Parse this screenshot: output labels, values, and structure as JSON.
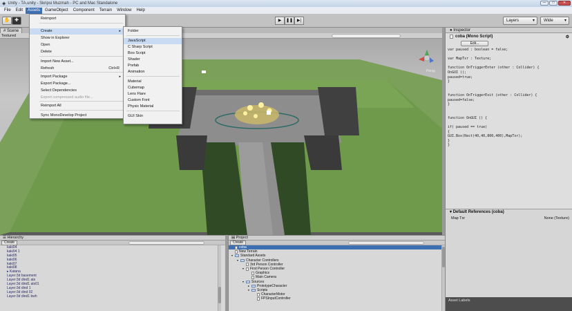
{
  "window": {
    "title": "Unity - TA.unity - Skripsi Muzmah - PC and Mac Standalone",
    "buttons": [
      "—",
      "□",
      "✕"
    ]
  },
  "menubar": [
    "File",
    "Edit",
    "Assets",
    "GameObject",
    "Component",
    "Terrain",
    "Window",
    "Help"
  ],
  "toolbar": {
    "play": "▶",
    "pause": "❚❚",
    "step": "▶|",
    "layers": "Layers",
    "layout": "Wide"
  },
  "scene": {
    "tab": "Scene",
    "mode": "Textured",
    "gizmo_label": "Persp"
  },
  "assets_menu": {
    "items": [
      {
        "label": "Reimport"
      },
      {
        "label": "Create",
        "arrow": "▸",
        "highlight": true
      },
      {
        "label": "Show in Explorer"
      },
      {
        "label": "Open"
      },
      {
        "label": "Delete"
      },
      {
        "label": "Import New Asset..."
      },
      {
        "label": "Refresh",
        "shortcut": "Ctrl+R"
      },
      {
        "label": "Import Package",
        "arrow": "▸"
      },
      {
        "label": "Export Package..."
      },
      {
        "label": "Select Dependencies"
      },
      {
        "label": "Export compressed audio file...",
        "disabled": true
      },
      {
        "label": "Reimport All"
      },
      {
        "label": "Sync MonoDevelop Project"
      }
    ]
  },
  "create_submenu": {
    "items": [
      "Folder",
      "JavaScript",
      "C Sharp Script",
      "Boo Script",
      "Shader",
      "Prefab",
      "Animation",
      "Material",
      "Cubemap",
      "Lens Flare",
      "Custom Font",
      "Physic Material",
      "GUI Skin"
    ],
    "highlight_index": 1
  },
  "inspector": {
    "tab": "Inspector",
    "component": "coba (Mono Script)",
    "edit_label": "Edit...",
    "code": "var paused : boolean = false;\n\nvar MapTxr : Texture;\n\nfunction OnTriggerEnter (other : Collider) {\nOnGUI ();\npaused=true;\n}\n\n\nfunction OnTriggerExit (other : Collider) {\npaused=false;\n}\n\n\nfunction OnGUI () {\n\nif( paused == true)\n{\nGUI.Box(Rect(40,40,800,400),MapTxr);\n}\n}",
    "default_refs_title": "Default References (coba)",
    "map_label": "Map Txr",
    "map_value": "None (Texture)",
    "asset_labels": "Asset Labels"
  },
  "hierarchy": {
    "tab": "Hierarchy",
    "create": "Create",
    "items": [
      "kaki04",
      "kaki04 1",
      "kaki05",
      "kaki06",
      "kaki07",
      "kaki08",
      "▸ Katana",
      "Layer:3d basement",
      "Layer:3d dind1 ats",
      "Layer:3d dind1 ats01",
      "Layer:3d dind 1",
      "Layer:3d dind 02",
      "Layer:3d dind1 bwh"
    ]
  },
  "project": {
    "tab": "Project",
    "create": "Create",
    "items": [
      {
        "label": "coba",
        "indent": 0,
        "type": "file",
        "selected": true
      },
      {
        "label": "New Terrain",
        "indent": 0,
        "type": "file"
      },
      {
        "label": "Standard Assets",
        "indent": 0,
        "type": "folder",
        "open": true
      },
      {
        "label": "Character Controllers",
        "indent": 1,
        "type": "folder",
        "open": true
      },
      {
        "label": "3rd Person Controller",
        "indent": 2,
        "type": "file"
      },
      {
        "label": "First Person Controller",
        "indent": 2,
        "type": "file",
        "open": true
      },
      {
        "label": "Graphics",
        "indent": 3,
        "type": "file"
      },
      {
        "label": "Main Camera",
        "indent": 3,
        "type": "file"
      },
      {
        "label": "Sources",
        "indent": 2,
        "type": "folder",
        "open": true
      },
      {
        "label": "PrototypeCharacter",
        "indent": 3,
        "type": "folder"
      },
      {
        "label": "Scripts",
        "indent": 3,
        "type": "folder",
        "open": true
      },
      {
        "label": "CharacterMotor",
        "indent": 4,
        "type": "file"
      },
      {
        "label": "FPSInputController",
        "indent": 4,
        "type": "file"
      }
    ]
  }
}
